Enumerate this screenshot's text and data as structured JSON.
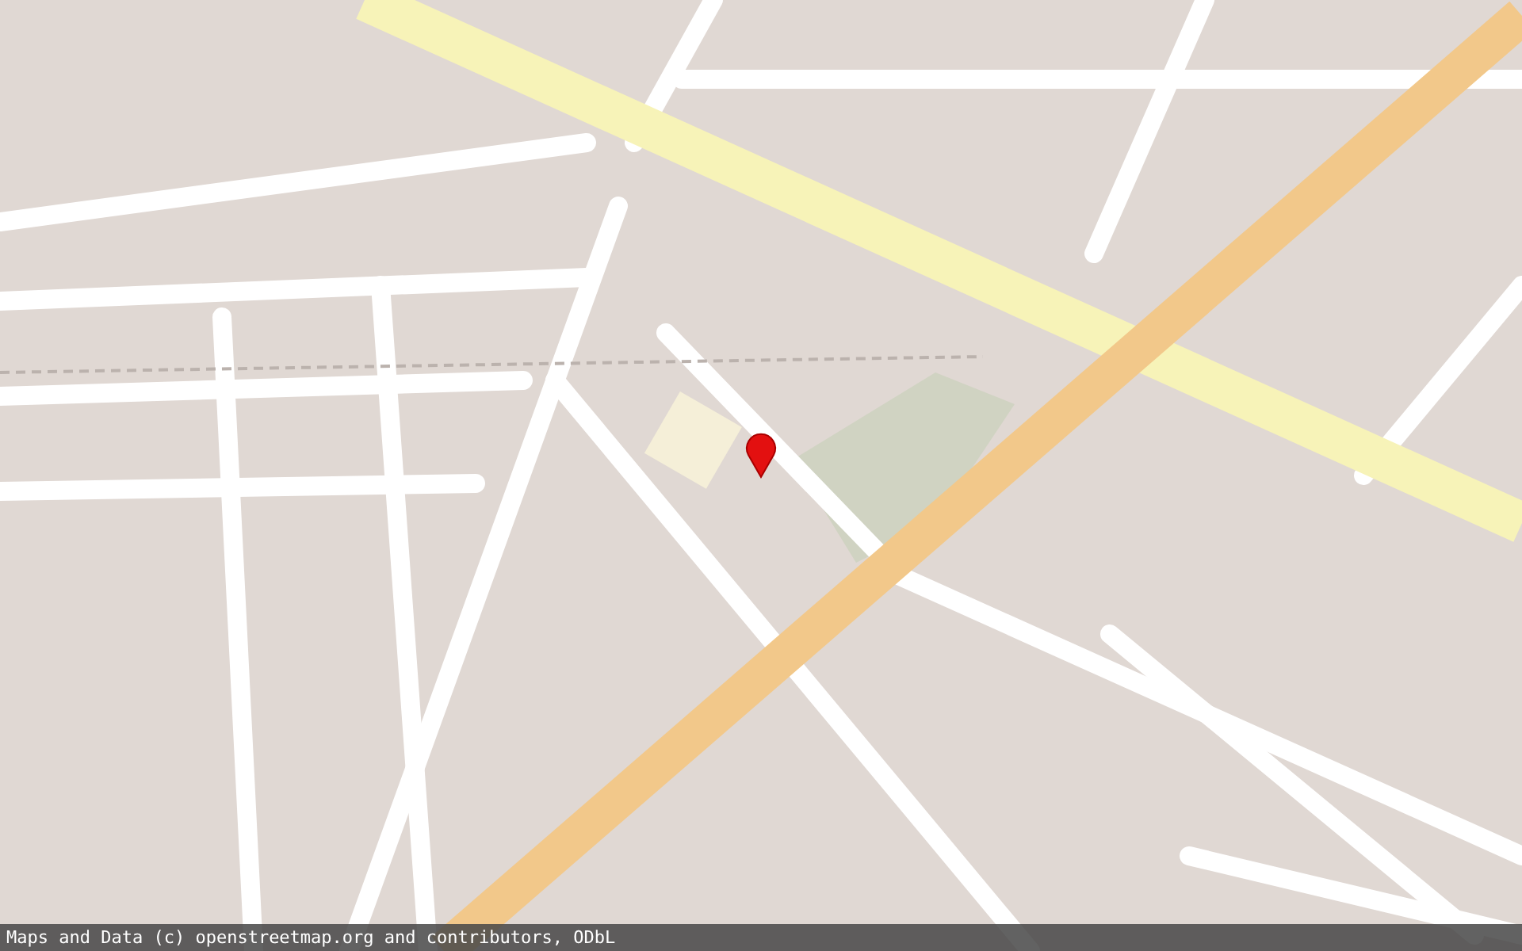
{
  "attribution_bar": {
    "text": "Maps and Data (c) openstreetmap.org and contributors, ODbL"
  }
}
